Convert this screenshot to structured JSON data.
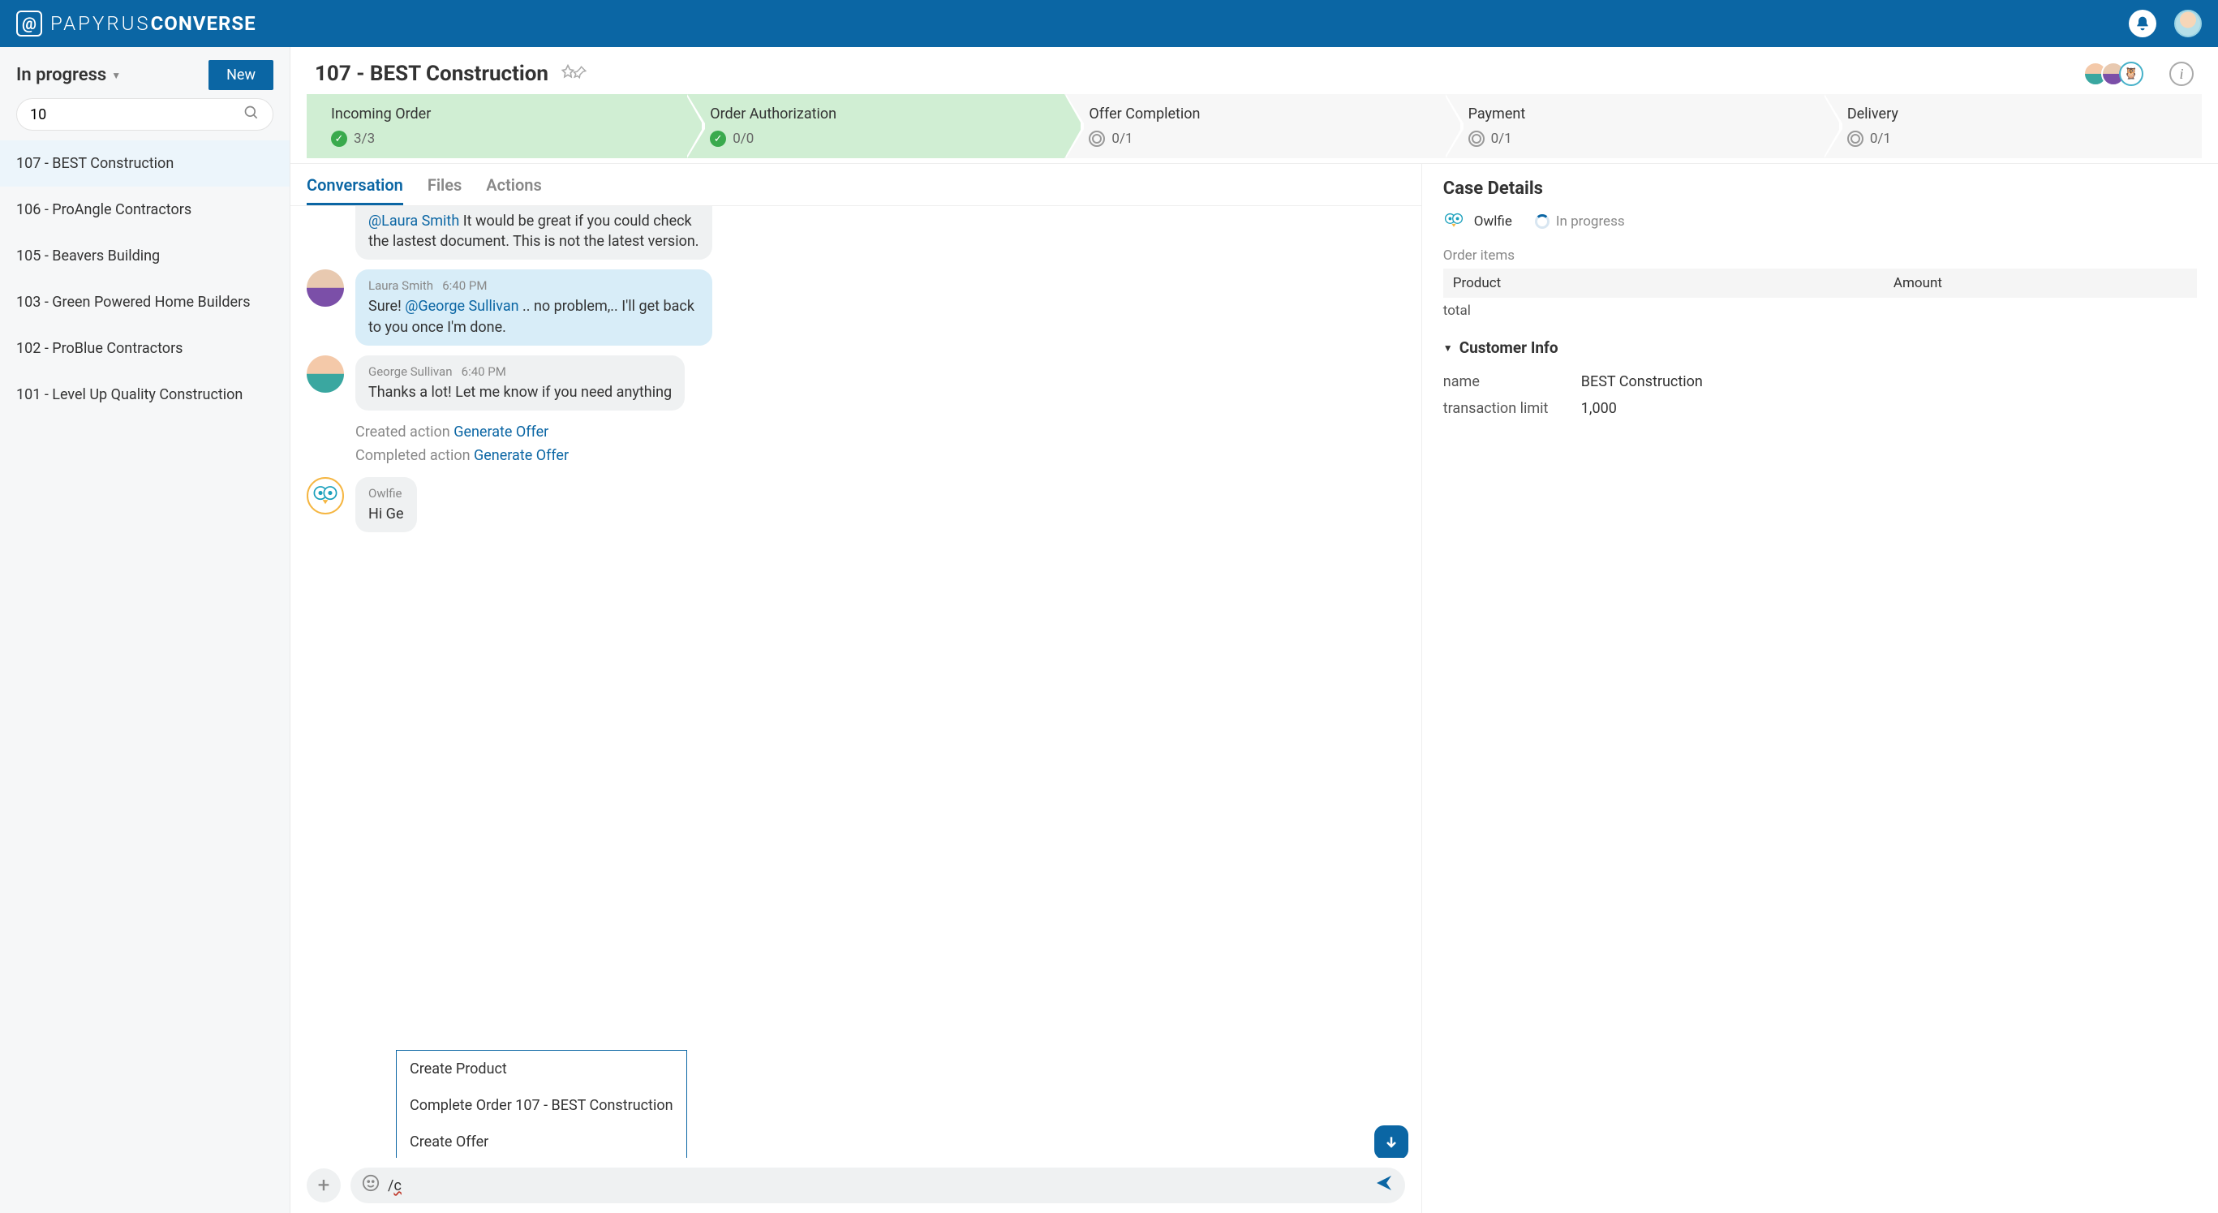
{
  "brand": {
    "text1": "PAPYRUS",
    "text2": "CONVERSE"
  },
  "sidebar": {
    "filter_label": "In progress",
    "new_button": "New",
    "search_value": "10",
    "cases": [
      {
        "label": "107 - BEST Construction",
        "active": true
      },
      {
        "label": "106 - ProAngle Contractors"
      },
      {
        "label": "105 - Beavers Building"
      },
      {
        "label": "103 - Green Powered Home Builders"
      },
      {
        "label": "102 - ProBlue Contractors"
      },
      {
        "label": "101 - Level Up Quality Construction"
      }
    ]
  },
  "case": {
    "title": "107 - BEST Construction",
    "stages": [
      {
        "name": "Incoming Order",
        "done": true,
        "count": "3/3"
      },
      {
        "name": "Order Authorization",
        "done": true,
        "count": "0/0"
      },
      {
        "name": "Offer Completion",
        "done": false,
        "count": "0/1"
      },
      {
        "name": "Payment",
        "done": false,
        "count": "0/1"
      },
      {
        "name": "Delivery",
        "done": false,
        "count": "0/1"
      }
    ],
    "tabs": [
      "Conversation",
      "Files",
      "Actions"
    ]
  },
  "conversation": {
    "cutoff": {
      "mention": "@Laura Smith",
      "text": " It would be great if you could check the lastest document. This is not the latest version."
    },
    "messages": [
      {
        "author": "Laura Smith",
        "time": "6:40 PM",
        "outgoing": true,
        "pre": "Sure! ",
        "mention": "@George Sullivan",
        "post": " .. no problem,.. I'll get back to you once I'm done."
      },
      {
        "author": "George Sullivan",
        "time": "6:40 PM",
        "outgoing": false,
        "pre": "Thanks a lot! Let me know if you need anything",
        "mention": "",
        "post": ""
      }
    ],
    "system": [
      {
        "prefix": "Created action ",
        "link": "Generate Offer"
      },
      {
        "prefix": "Completed action ",
        "link": "Generate Offer"
      }
    ],
    "owlfie": {
      "author": "Owlfie",
      "text_visible": "Hi Ge"
    },
    "typed": "/c",
    "suggestions": [
      "Create Product",
      "Complete Order 107 - BEST Construction",
      "Create Offer"
    ]
  },
  "details": {
    "heading": "Case Details",
    "assignee": "Owlfie",
    "status": "In progress",
    "order_items_label": "Order items",
    "columns": {
      "product": "Product",
      "amount": "Amount"
    },
    "total_label": "total",
    "customer_info_heading": "Customer Info",
    "fields": {
      "name_label": "name",
      "name_value": "BEST Construction",
      "limit_label": "transaction limit",
      "limit_value": "1,000"
    }
  }
}
